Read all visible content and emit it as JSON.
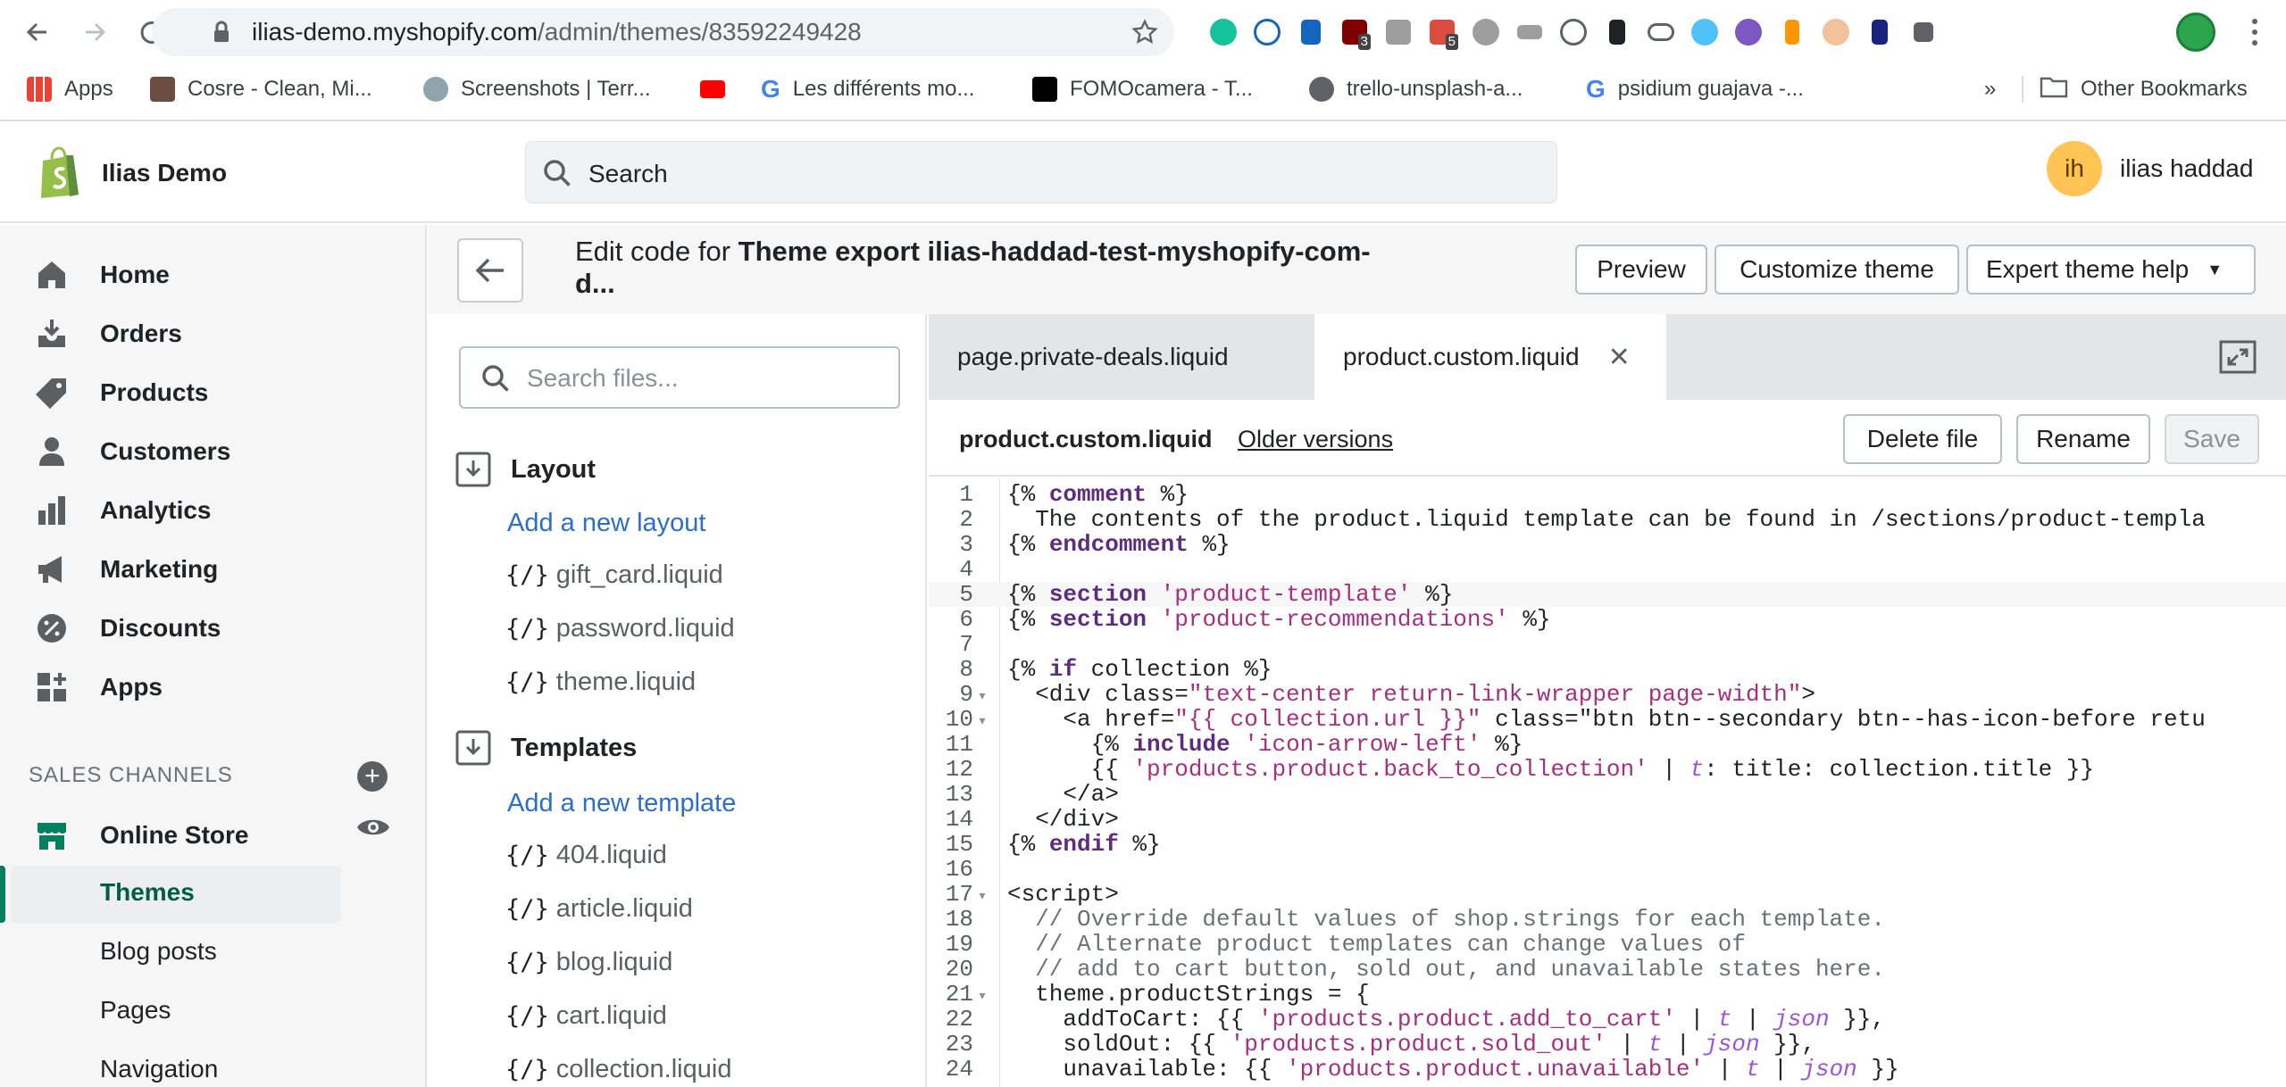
{
  "browser": {
    "url_host": "ilias-demo.myshopify.com",
    "url_path": "/admin/themes/83592249428",
    "bookmarks": [
      "Apps",
      "Cosre - Clean, Mi...",
      "Screenshots | Terr...",
      "",
      "Les différents mo...",
      "FOMOcamera - T...",
      "trello-unsplash-a...",
      "psidium guajava -..."
    ],
    "bookmarks_more": "»",
    "other_bookmarks": "Other Bookmarks",
    "ext_badges": [
      "3",
      "5"
    ]
  },
  "shop": {
    "name": "Ilias Demo",
    "search_placeholder": "Search",
    "user_initials": "ih",
    "user_name": "ilias haddad"
  },
  "nav": {
    "items": [
      "Home",
      "Orders",
      "Products",
      "Customers",
      "Analytics",
      "Marketing",
      "Discounts",
      "Apps"
    ],
    "sales_channels_label": "SALES CHANNELS",
    "online_store": "Online Store",
    "sub_items": [
      "Themes",
      "Blog posts",
      "Pages",
      "Navigation"
    ]
  },
  "header": {
    "title_prefix": "Edit code for ",
    "title_bold": "Theme export ilias-haddad-test-myshopify-com-d...",
    "buttons": [
      "Preview",
      "Customize theme",
      "Expert theme help"
    ]
  },
  "files": {
    "search_placeholder": "Search files...",
    "layout_label": "Layout",
    "add_layout": "Add a new layout",
    "layout_files": [
      "gift_card.liquid",
      "password.liquid",
      "theme.liquid"
    ],
    "templates_label": "Templates",
    "add_template": "Add a new template",
    "template_files": [
      "404.liquid",
      "article.liquid",
      "blog.liquid",
      "cart.liquid",
      "collection.liquid"
    ],
    "file_icon": "{/}"
  },
  "editor": {
    "tabs": [
      "page.private-deals.liquid",
      "product.custom.liquid"
    ],
    "close_glyph": "✕",
    "file_name": "product.custom.liquid",
    "older_versions": "Older versions",
    "actions": [
      "Delete file",
      "Rename",
      "Save"
    ],
    "lines": [
      "{% comment %}",
      "  The contents of the product.liquid template can be found in /sections/product-templa",
      "{% endcomment %}",
      "",
      "{% section 'product-template' %}",
      "{% section 'product-recommendations' %}",
      "",
      "{% if collection %}",
      "  <div class=\"text-center return-link-wrapper page-width\">",
      "    <a href=\"{{ collection.url }}\" class=\"btn btn--secondary btn--has-icon-before retu",
      "      {% include 'icon-arrow-left' %}",
      "      {{ 'products.product.back_to_collection' | t: title: collection.title }}",
      "    </a>",
      "  </div>",
      "{% endif %}",
      "",
      "<script>",
      "  // Override default values of shop.strings for each template.",
      "  // Alternate product templates can change values of",
      "  // add to cart button, sold out, and unavailable states here.",
      "  theme.productStrings = {",
      "    addToCart: {{ 'products.product.add_to_cart' | t | json }},",
      "    soldOut: {{ 'products.product.sold_out' | t | json }},",
      "    unavailable: {{ 'products.product.unavailable' | t | json }}"
    ],
    "fold_lines": [
      9,
      10,
      17,
      21
    ],
    "current_line": 5
  },
  "colors": {
    "shopify_green": "#008060",
    "link_blue": "#2c6ecb",
    "keyword": "#5e2c7f",
    "string": "#a5307d"
  }
}
